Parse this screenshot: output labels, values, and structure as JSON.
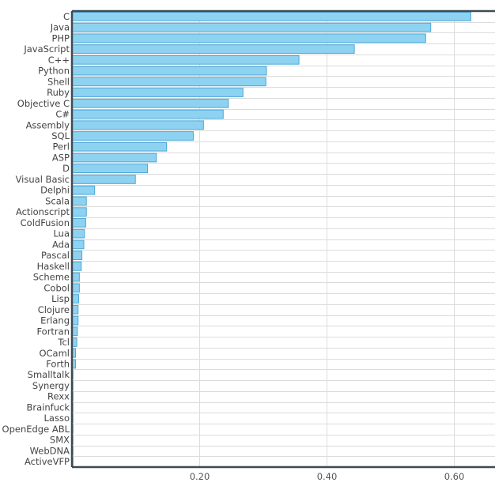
{
  "chart_data": {
    "type": "bar",
    "orientation": "horizontal",
    "title": "",
    "xlabel": "",
    "ylabel": "",
    "xlim": [
      0,
      0.665
    ],
    "xticks": [
      0.2,
      0.4,
      0.6
    ],
    "xtick_labels": [
      "0.20",
      "0.40",
      "0.60"
    ],
    "grid": true,
    "legend": "none",
    "bar_color": "#8dd3f1",
    "bar_border_color": "#4ba6d6",
    "categories": [
      "C",
      "Java",
      "PHP",
      "JavaScript",
      "C++",
      "Python",
      "Shell",
      "Ruby",
      "Objective C",
      "C#",
      "Assembly",
      "SQL",
      "Perl",
      "ASP",
      "D",
      "Visual Basic",
      "Delphi",
      "Scala",
      "Actionscript",
      "ColdFusion",
      "Lua",
      "Ada",
      "Pascal",
      "Haskell",
      "Scheme",
      "Cobol",
      "Lisp",
      "Clojure",
      "Erlang",
      "Fortran",
      "Tcl",
      "OCaml",
      "Forth",
      "Smalltalk",
      "Synergy",
      "Rexx",
      "Brainfuck",
      "Lasso",
      "OpenEdge ABL",
      "SMX",
      "WebDNA",
      "ActiveVFP"
    ],
    "values": [
      0.626,
      0.563,
      0.555,
      0.443,
      0.356,
      0.305,
      0.304,
      0.268,
      0.245,
      0.237,
      0.206,
      0.19,
      0.148,
      0.132,
      0.118,
      0.099,
      0.035,
      0.022,
      0.022,
      0.021,
      0.019,
      0.018,
      0.015,
      0.014,
      0.011,
      0.011,
      0.01,
      0.009,
      0.009,
      0.008,
      0.007,
      0.005,
      0.005,
      0.001,
      0.001,
      0.001,
      0.001,
      0.001,
      0.001,
      0.001,
      0.001,
      0.001
    ]
  }
}
